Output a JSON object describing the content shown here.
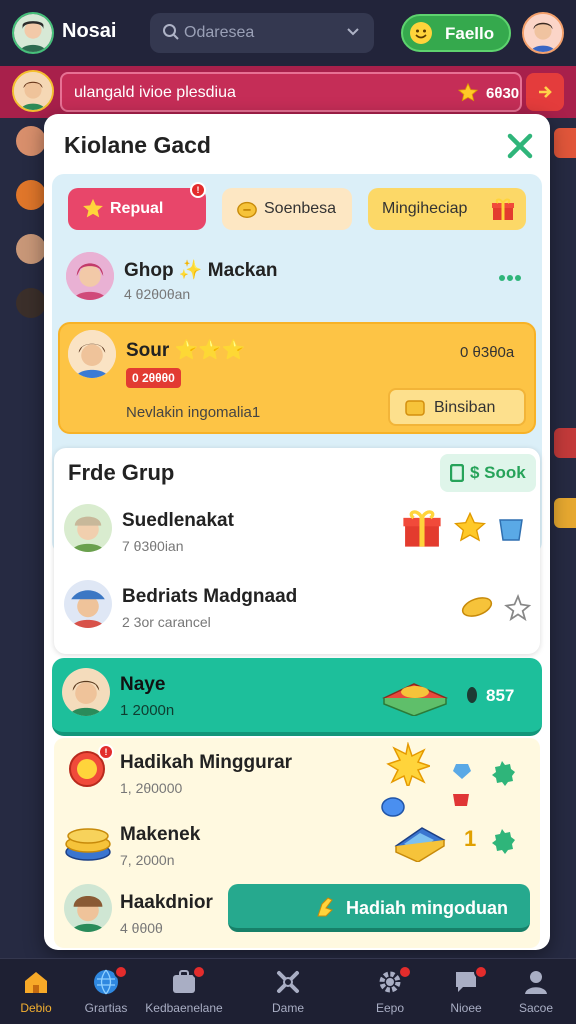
{
  "header": {
    "title": "Nosai",
    "search_placeholder": "Odaresea",
    "profile_button": "Faello",
    "accent": "#35a94d"
  },
  "banner": {
    "text": "ulangald ivioe plesdiua",
    "count": "6θ30"
  },
  "modal": {
    "title": "Kiolane Gacd",
    "tabs": [
      {
        "label": "Repual",
        "icon": "star-icon",
        "active": true
      },
      {
        "label": "Soenbesa",
        "icon": "coin-icon"
      },
      {
        "label": "Mingiheciap",
        "icon": "gift-icon"
      }
    ],
    "row1": {
      "name": "Ghop ✨ Mackan",
      "sub": "4 θ2θ0θan"
    },
    "featured": {
      "name": "Sour ⭐⭐⭐",
      "tag": "0 2θθθ0",
      "right": "0 θ3θ0a",
      "desc": "Nevlakin ingomalia1",
      "button": "Binsiban"
    },
    "group": {
      "title": "Frde Grup",
      "button": "$ Sook",
      "items": [
        {
          "name": "Suedlenakat",
          "sub": "7 θ3θ0ian"
        },
        {
          "name": "Bedriats Madgnaad",
          "sub": "2 3or carancel"
        }
      ]
    },
    "teal": {
      "name": "Naye",
      "sub": "1 2000n",
      "count": "857"
    },
    "rewards": [
      {
        "name": "Hadikah Minggurar",
        "sub": "1, 2θ0000"
      },
      {
        "name": "Makenek",
        "sub": "7, 2000n"
      },
      {
        "name": "Haakdnior",
        "sub": "4 θθ0θ"
      }
    ],
    "reward_count": "1",
    "reward_button": "Hadiah mingoduan"
  },
  "nav": [
    {
      "label": "Debio",
      "icon": "home-icon",
      "active": true
    },
    {
      "label": "Grartias",
      "icon": "globe-icon",
      "badge": true
    },
    {
      "label": "Kedbaenelane",
      "icon": "bag-icon",
      "badge": true
    },
    {
      "label": "Dame",
      "icon": "game-icon"
    },
    {
      "label": "Eepo",
      "icon": "gear-icon",
      "badge": true
    },
    {
      "label": "Nioee",
      "icon": "message-icon",
      "badge": true
    },
    {
      "label": "Sacoe",
      "icon": "user-icon"
    }
  ]
}
